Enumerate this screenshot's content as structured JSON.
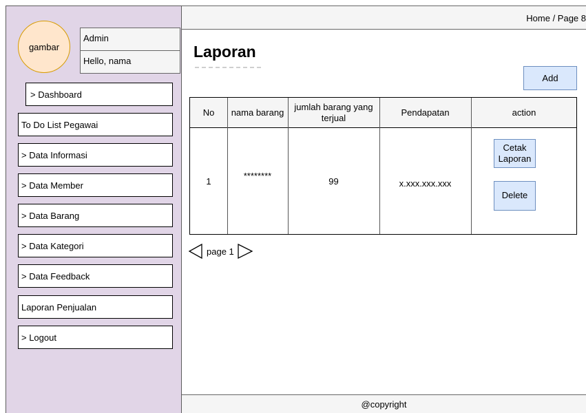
{
  "sidebar": {
    "avatar_text": "gambar",
    "role": "Admin",
    "greeting": "Hello, nama",
    "items": [
      {
        "label": "> Dashboard"
      },
      {
        "label": "To Do List Pegawai"
      },
      {
        "label": "> Data Informasi"
      },
      {
        "label": "> Data Member"
      },
      {
        "label": "> Data Barang"
      },
      {
        "label": "> Data Kategori"
      },
      {
        "label": "> Data Feedback"
      },
      {
        "label": "Laporan Penjualan"
      },
      {
        "label": "> Logout"
      }
    ]
  },
  "header": {
    "breadcrumb": "Home / Page 8"
  },
  "main": {
    "title": "Laporan",
    "add_label": "Add",
    "table": {
      "columns": [
        "No",
        "nama barang",
        "jumlah barang yang terjual",
        "Pendapatan",
        "action"
      ],
      "rows": [
        {
          "no": "1",
          "nama_barang": "********",
          "jumlah": "99",
          "pendapatan": "x.xxx.xxx.xxx",
          "actions": [
            "Cetak Laporan",
            "Delete"
          ]
        }
      ]
    },
    "pagination": {
      "label": "page 1",
      "prev_icon": "triangle-left-icon",
      "next_icon": "triangle-right-icon"
    }
  },
  "footer": {
    "text": "@copyright"
  },
  "colors": {
    "sidebar_bg": "#e1d5e7",
    "avatar_bg": "#ffe6cc",
    "avatar_border": "#d79b00",
    "button_bg": "#dae8fc",
    "button_border": "#6c8ebf",
    "bar_bg": "#f5f5f5"
  }
}
